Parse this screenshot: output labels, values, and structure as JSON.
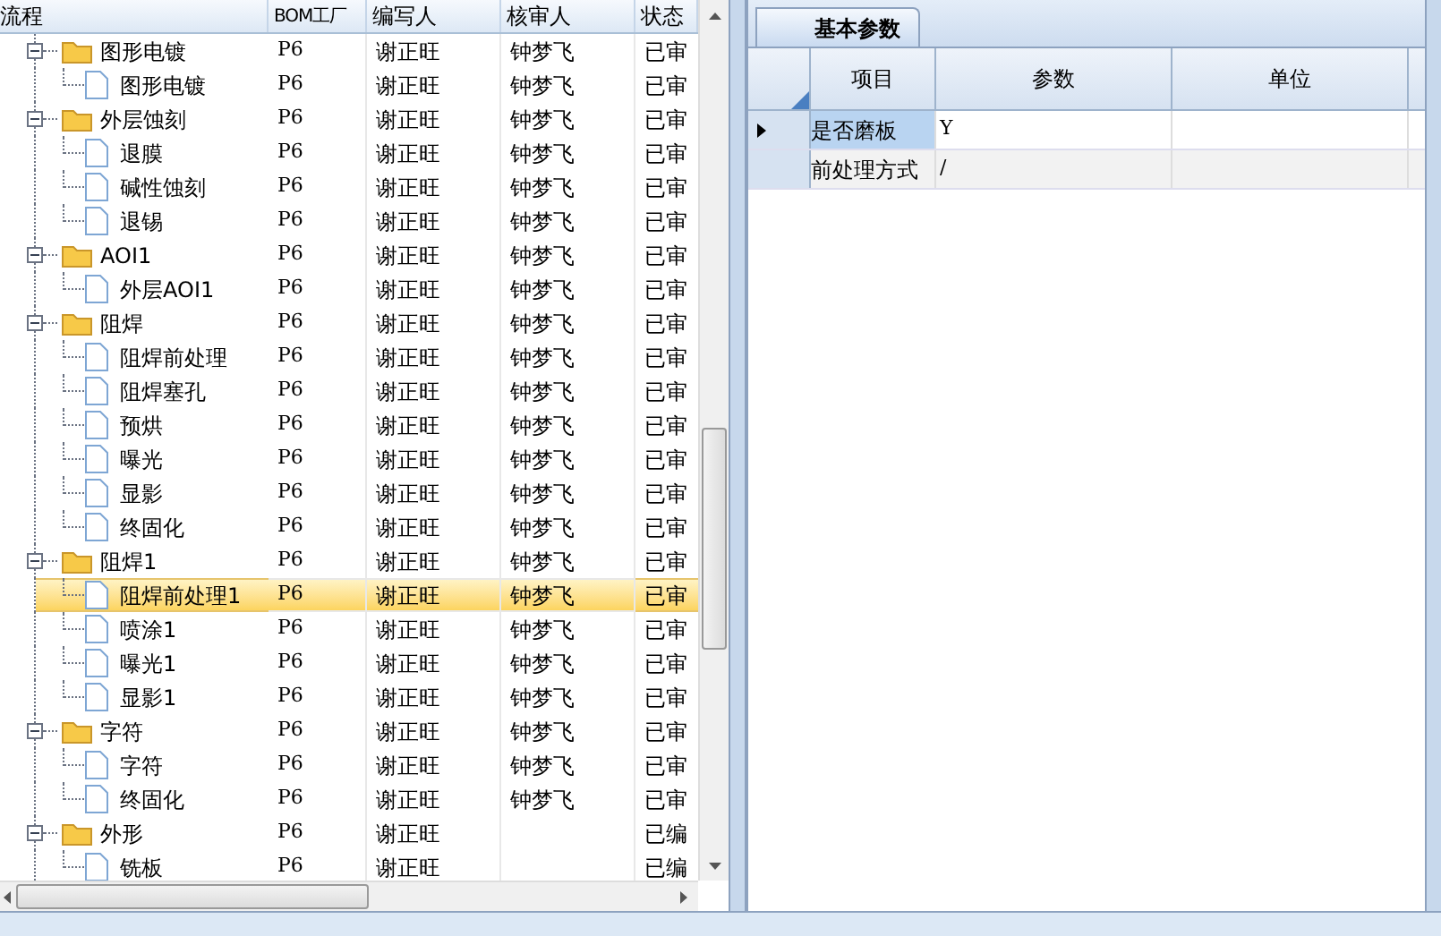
{
  "tree": {
    "columns": [
      "流程",
      "BOM工厂",
      "编写人",
      "核审人",
      "状态"
    ],
    "nodes": [
      {
        "label": "图形电镀",
        "bom": "P6",
        "writer": "谢正旺",
        "reviewer": "钟梦飞",
        "status": "已审",
        "expanded": true,
        "selected": false,
        "children": [
          {
            "label": "图形电镀",
            "bom": "P6",
            "writer": "谢正旺",
            "reviewer": "钟梦飞",
            "status": "已审",
            "selected": false
          }
        ]
      },
      {
        "label": "外层蚀刻",
        "bom": "P6",
        "writer": "谢正旺",
        "reviewer": "钟梦飞",
        "status": "已审",
        "expanded": true,
        "selected": false,
        "children": [
          {
            "label": "退膜",
            "bom": "P6",
            "writer": "谢正旺",
            "reviewer": "钟梦飞",
            "status": "已审",
            "selected": false
          },
          {
            "label": "碱性蚀刻",
            "bom": "P6",
            "writer": "谢正旺",
            "reviewer": "钟梦飞",
            "status": "已审",
            "selected": false
          },
          {
            "label": "退锡",
            "bom": "P6",
            "writer": "谢正旺",
            "reviewer": "钟梦飞",
            "status": "已审",
            "selected": false
          }
        ]
      },
      {
        "label": "AOI1",
        "bom": "P6",
        "writer": "谢正旺",
        "reviewer": "钟梦飞",
        "status": "已审",
        "expanded": true,
        "selected": false,
        "children": [
          {
            "label": "外层AOI1",
            "bom": "P6",
            "writer": "谢正旺",
            "reviewer": "钟梦飞",
            "status": "已审",
            "selected": false
          }
        ]
      },
      {
        "label": "阻焊",
        "bom": "P6",
        "writer": "谢正旺",
        "reviewer": "钟梦飞",
        "status": "已审",
        "expanded": true,
        "selected": false,
        "children": [
          {
            "label": "阻焊前处理",
            "bom": "P6",
            "writer": "谢正旺",
            "reviewer": "钟梦飞",
            "status": "已审",
            "selected": false
          },
          {
            "label": "阻焊塞孔",
            "bom": "P6",
            "writer": "谢正旺",
            "reviewer": "钟梦飞",
            "status": "已审",
            "selected": false
          },
          {
            "label": "预烘",
            "bom": "P6",
            "writer": "谢正旺",
            "reviewer": "钟梦飞",
            "status": "已审",
            "selected": false
          },
          {
            "label": "曝光",
            "bom": "P6",
            "writer": "谢正旺",
            "reviewer": "钟梦飞",
            "status": "已审",
            "selected": false
          },
          {
            "label": "显影",
            "bom": "P6",
            "writer": "谢正旺",
            "reviewer": "钟梦飞",
            "status": "已审",
            "selected": false
          },
          {
            "label": "终固化",
            "bom": "P6",
            "writer": "谢正旺",
            "reviewer": "钟梦飞",
            "status": "已审",
            "selected": false
          }
        ]
      },
      {
        "label": "阻焊1",
        "bom": "P6",
        "writer": "谢正旺",
        "reviewer": "钟梦飞",
        "status": "已审",
        "expanded": true,
        "selected": false,
        "children": [
          {
            "label": "阻焊前处理1",
            "bom": "P6",
            "writer": "谢正旺",
            "reviewer": "钟梦飞",
            "status": "已审",
            "selected": true
          },
          {
            "label": "喷涂1",
            "bom": "P6",
            "writer": "谢正旺",
            "reviewer": "钟梦飞",
            "status": "已审",
            "selected": false
          },
          {
            "label": "曝光1",
            "bom": "P6",
            "writer": "谢正旺",
            "reviewer": "钟梦飞",
            "status": "已审",
            "selected": false
          },
          {
            "label": "显影1",
            "bom": "P6",
            "writer": "谢正旺",
            "reviewer": "钟梦飞",
            "status": "已审",
            "selected": false
          }
        ]
      },
      {
        "label": "字符",
        "bom": "P6",
        "writer": "谢正旺",
        "reviewer": "钟梦飞",
        "status": "已审",
        "expanded": true,
        "selected": false,
        "children": [
          {
            "label": "字符",
            "bom": "P6",
            "writer": "谢正旺",
            "reviewer": "钟梦飞",
            "status": "已审",
            "selected": false
          },
          {
            "label": "终固化",
            "bom": "P6",
            "writer": "谢正旺",
            "reviewer": "钟梦飞",
            "status": "已审",
            "selected": false
          }
        ]
      },
      {
        "label": "外形",
        "bom": "P6",
        "writer": "谢正旺",
        "status": "已编",
        "expanded": true,
        "selected": false,
        "children": [
          {
            "label": "铣板",
            "bom": "P6",
            "writer": "谢正旺",
            "status": "已编",
            "selected": false
          }
        ]
      }
    ]
  },
  "params": {
    "tabs": [
      {
        "label": "基本参数",
        "selected": true
      }
    ],
    "columns": [
      "项目",
      "参数",
      "单位"
    ],
    "rows": [
      {
        "item": "是否磨板",
        "value": "Y",
        "selected": true
      },
      {
        "item": "前处理方式",
        "value": "/",
        "selected": false
      }
    ]
  }
}
